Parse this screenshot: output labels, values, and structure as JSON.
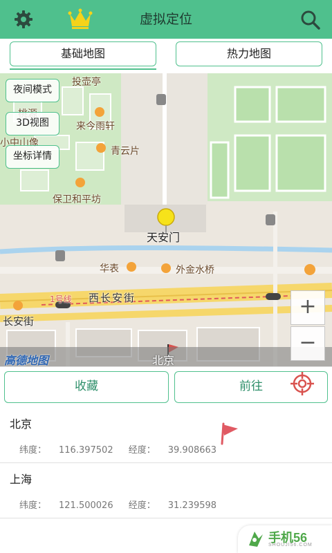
{
  "header": {
    "title": "虚拟定位",
    "left_icon": "gear-icon",
    "vip_icon": "crown-icon",
    "right_icon": "search-icon",
    "color": "#4fc08d"
  },
  "tabs": [
    {
      "label": "基础地图",
      "active": true
    },
    {
      "label": "热力地图",
      "active": false
    }
  ],
  "map": {
    "buttons": [
      "夜间模式",
      "3D视图",
      "坐标详情"
    ],
    "zoom_in": "+",
    "zoom_out": "−",
    "logo": "高德地图",
    "bottom_label": "北京",
    "labels": {
      "l1": "投壶亭",
      "l2": "桃源",
      "l3": "来今雨轩",
      "l4": "小中山像",
      "l5": "青云片",
      "l6": "保卫和平坊",
      "marker": "天安门",
      "l7": "华表",
      "l8": "外金水桥",
      "line": "1号线",
      "street": "西长安街",
      "street2": "长安街"
    }
  },
  "actions": {
    "favorite": "收藏",
    "go": "前往",
    "target_icon": "crosshair-icon"
  },
  "locations": [
    {
      "city": "北京",
      "lat_label": "纬度：",
      "lat": "116.397502",
      "lng_label": "经度：",
      "lng": "39.908663",
      "flag": true
    },
    {
      "city": "上海",
      "lat_label": "纬度：",
      "lat": "121.500026",
      "lng_label": "经度：",
      "lng": "31.239598",
      "flag": false
    }
  ],
  "watermark": {
    "text": "手机56",
    "sub": "SHOUJI56.COM"
  }
}
